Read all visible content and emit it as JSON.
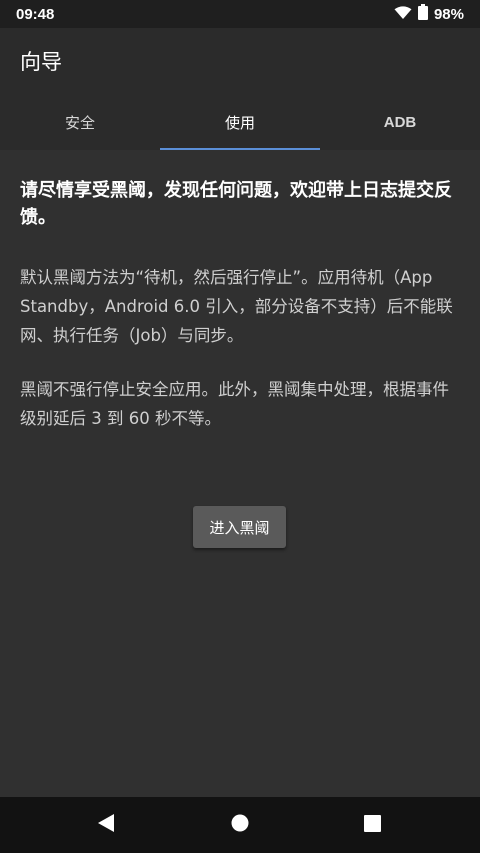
{
  "status_bar": {
    "time": "09:48",
    "battery_text": "98%",
    "icons": [
      "wifi-icon",
      "battery-icon"
    ]
  },
  "app_bar": {
    "title": "向导"
  },
  "tabs": [
    {
      "label": "安全",
      "active": false
    },
    {
      "label": "使用",
      "active": true
    },
    {
      "label": "ADB",
      "active": false
    }
  ],
  "content": {
    "intro": "请尽情享受黑阈，发现任何问题，欢迎带上日志提交反馈。",
    "paragraph1": "默认黑阈方法为“待机，然后强行停止”。应用待机（App Standby，Android 6.0 引入，部分设备不支持）后不能联网、执行任务（Job）与同步。",
    "paragraph2": "黑阈不强行停止安全应用。此外，黑阈集中处理，根据事件级别延后 3 到 60 秒不等。",
    "enter_button": "进入黑阈"
  },
  "nav_bar": {
    "icons": [
      "back-icon",
      "home-icon",
      "recents-icon"
    ]
  },
  "colors": {
    "background": "#303030",
    "app_bar": "#2b2b2b",
    "status_bar": "#1f1f1f",
    "accent": "#5b8fd8",
    "button": "#5a5a5a",
    "nav_bar": "#121212"
  }
}
